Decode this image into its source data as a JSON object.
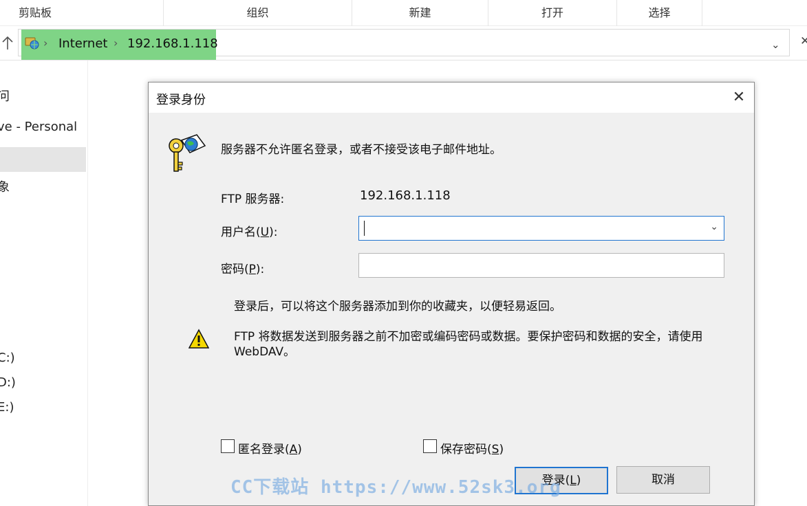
{
  "ribbon": {
    "groups": [
      "剪贴板",
      "组织",
      "新建",
      "打开",
      "选择"
    ]
  },
  "address_bar": {
    "crumbs": [
      "Internet",
      "192.168.1.118"
    ],
    "highlight_color": "#7fd486"
  },
  "nav_pane": {
    "items": [
      "问",
      "ve - Personal",
      "",
      "象",
      "C:)",
      "D:)",
      "E:)"
    ]
  },
  "dialog": {
    "title": "登录身份",
    "message": "服务器不允许匿名登录，或者不接受该电子邮件地址。",
    "ftp_server_label": "FTP 服务器:",
    "ftp_server_value": "192.168.1.118",
    "username_label_pre": "用户名(",
    "username_label_key": "U",
    "username_label_post": "):",
    "username_value": "",
    "password_label_pre": "密码(",
    "password_label_key": "P",
    "password_label_post": "):",
    "password_value": "",
    "note": "登录后，可以将这个服务器添加到你的收藏夹，以便轻易返回。",
    "warning": "FTP 将数据发送到服务器之前不加密或编码密码或数据。要保护密码和数据的安全，请使用 WebDAV。",
    "anon_label_pre": "匿名登录(",
    "anon_label_key": "A",
    "anon_label_post": ")",
    "save_pw_label_pre": "保存密码(",
    "save_pw_label_key": "S",
    "save_pw_label_post": ")",
    "login_pre": "登录(",
    "login_key": "L",
    "login_post": ")",
    "cancel": "取消",
    "accent_color": "#1f74d0"
  },
  "watermark": "CC下载站 https://www.52sk3.org"
}
